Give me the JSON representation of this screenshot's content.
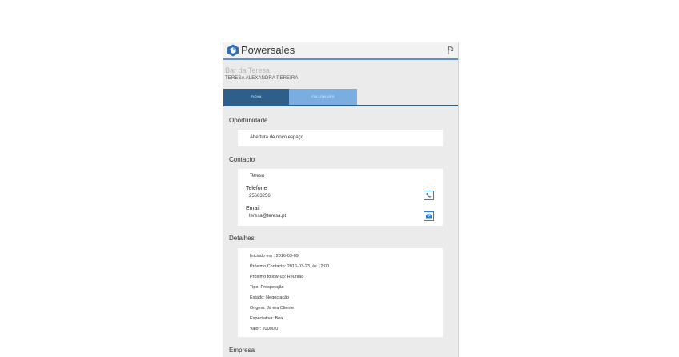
{
  "app": {
    "title": "Powersales"
  },
  "client": {
    "name": "Bar da Teresa",
    "person": "TERESA ALEXANDRA PEREIRA"
  },
  "tabs": [
    {
      "label": "FICHA"
    },
    {
      "label": "FOLLOW-UPS"
    }
  ],
  "sections": {
    "oportunidade": {
      "title": "Oportunidade",
      "value": "Abertura de novo espaço"
    },
    "contacto": {
      "title": "Contacto",
      "name": "Teresa",
      "phone_label": "Telefone",
      "phone_value": "25663256",
      "email_label": "Email",
      "email_value": "teresa@teresa.pt"
    },
    "detalhes": {
      "title": "Detalhes",
      "lines": [
        "Iniciado em : 2016-03-09",
        "Próximo Contacto: 2016-03-23, às 12:00",
        "Próximo follow-up: Reunião",
        "Tipo: Prospecção",
        "Estado: Negociação",
        "Origem: Já era Cliente",
        "Expectativa: Boa",
        "Valor: 20000.0"
      ]
    },
    "empresa": {
      "title": "Empresa"
    }
  },
  "colors": {
    "accent": "#5a8fc7",
    "tab_active": "#2e5f8a",
    "tab_inactive": "#7aaee0",
    "icon_blue": "#2f7fd6"
  },
  "icons": {
    "logo": "powersales-logo-icon",
    "flag": "flag-icon",
    "phone": "phone-icon",
    "email": "email-icon"
  }
}
